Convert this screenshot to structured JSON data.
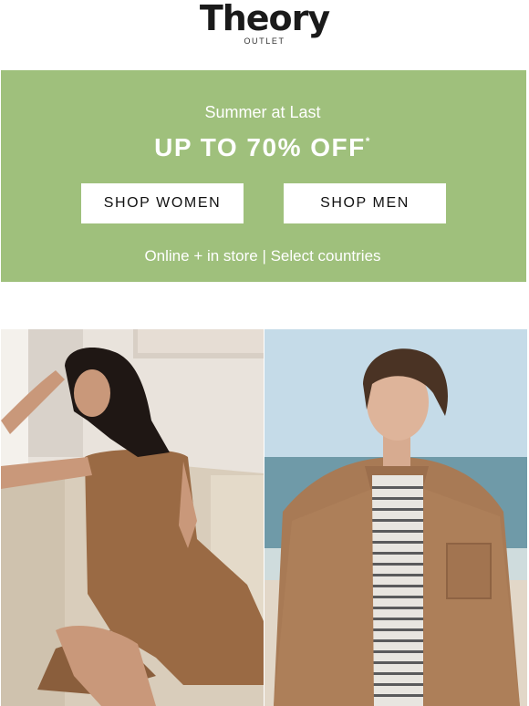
{
  "logo": {
    "wordmark": "Theory",
    "sub": "OUTLET"
  },
  "banner": {
    "kicker": "Summer at Last",
    "headline": "UP TO 70% OFF",
    "footnote_mark": "*",
    "shop_women_label": "SHOP WOMEN",
    "shop_men_label": "SHOP MEN",
    "availability": "Online + in store | Select countries",
    "background_color": "#9fc07c"
  },
  "images": [
    {
      "name": "women-photo",
      "subject": "woman in brown sleeveless dress on sofa"
    },
    {
      "name": "men-photo",
      "subject": "man in tan suede jacket at the beach"
    }
  ]
}
